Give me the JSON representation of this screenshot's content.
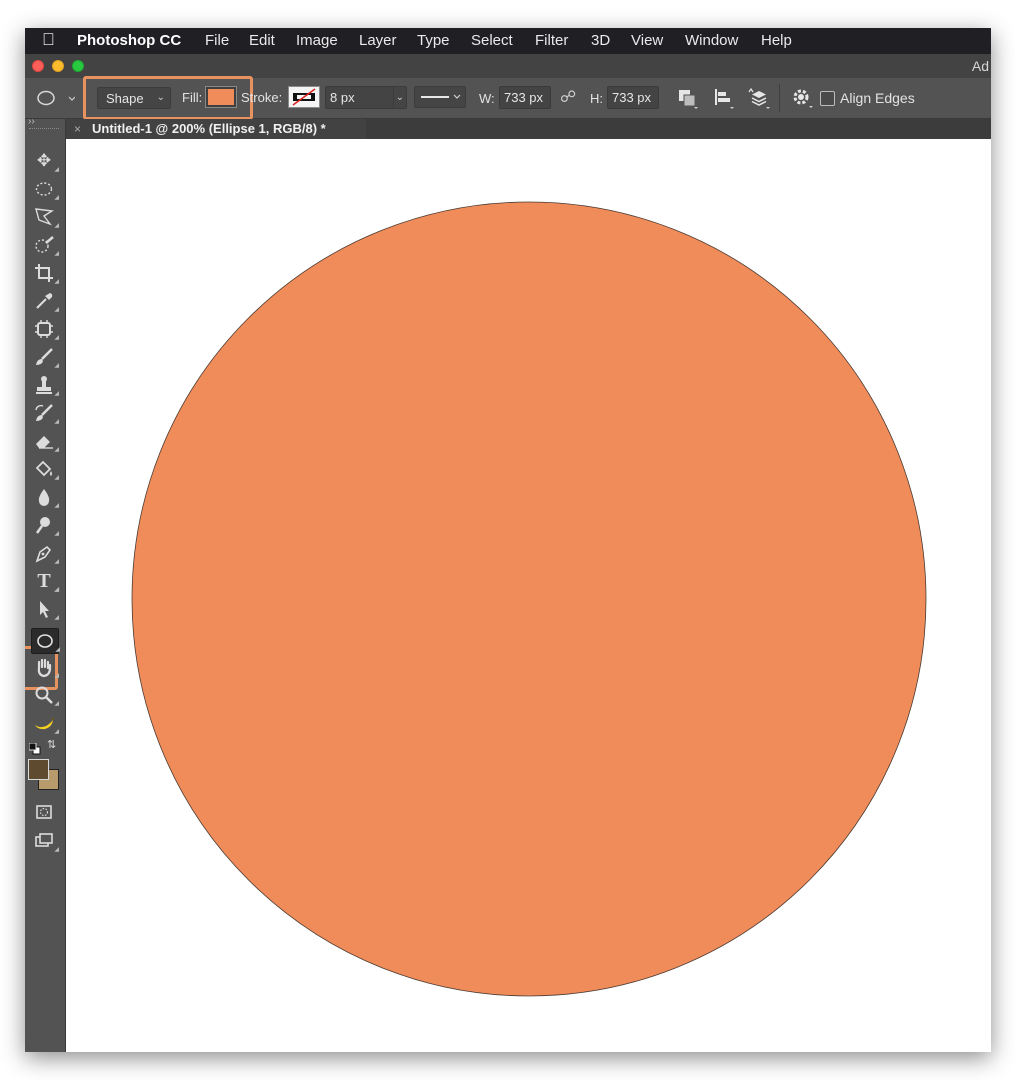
{
  "menubar": {
    "app_name": "Photoshop CC",
    "items": [
      "File",
      "Edit",
      "Image",
      "Layer",
      "Type",
      "Select",
      "Filter",
      "3D",
      "View",
      "Window",
      "Help"
    ]
  },
  "titlebar": {
    "app_short": "Ad"
  },
  "options": {
    "tool_mode": "Shape",
    "fill_label": "Fill:",
    "stroke_label": "Stroke:",
    "stroke_width": "8 px",
    "width_label": "W:",
    "width_value": "733 px",
    "height_label": "H:",
    "height_value": "733 px",
    "align_edges_label": "Align Edges",
    "align_edges_checked": false,
    "fill_color": "#f08c5a"
  },
  "document": {
    "tab_close": "×",
    "tab_title": "Untitled-1 @ 200% (Ellipse 1, RGB/8) *"
  },
  "canvas": {
    "shape": "ellipse",
    "fill_color": "#f08c5a",
    "stroke_color": "#4a3a32"
  },
  "colors": {
    "foreground": "#5e4a2e",
    "background": "#b79b6c",
    "highlight": "#e8935f"
  },
  "tools": [
    "move",
    "elliptical-marquee",
    "polygonal-lasso",
    "quick-selection",
    "crop",
    "eyedropper",
    "spot-healing",
    "brush",
    "clone-stamp",
    "history-brush",
    "eraser",
    "paint-bucket",
    "blur",
    "dodge",
    "pen",
    "type",
    "path-selection",
    "ellipse",
    "hand",
    "zoom",
    "banana"
  ],
  "active_tool": "ellipse"
}
